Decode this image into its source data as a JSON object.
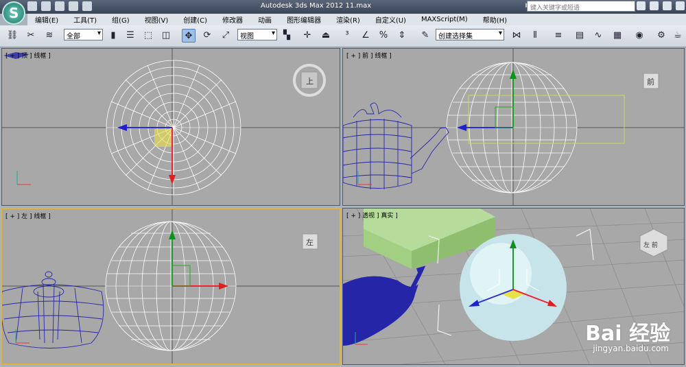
{
  "title": "Autodesk 3ds Max  2012      11.max",
  "search_placeholder": "键入关键字或短语",
  "menus": [
    "编辑(E)",
    "工具(T)",
    "组(G)",
    "视图(V)",
    "创建(C)",
    "修改器",
    "动画",
    "图形编辑器",
    "渲染(R)",
    "自定义(U)",
    "MAXScript(M)",
    "帮助(H)"
  ],
  "toolbar": {
    "filter": "全部",
    "coord": "视图",
    "selection_set": "创建选择集"
  },
  "viewports": {
    "top": {
      "label": "[ + ] 顶 ] 线框 ]",
      "cube": "上"
    },
    "front": {
      "label": "[ + ] 前 ] 线框 ]",
      "cube": "前"
    },
    "left": {
      "label": "[ + ] 左 ] 线框 ]",
      "cube": "左"
    },
    "perspective": {
      "label": "[ + ] 透视 ] 真实 ]",
      "cube": "左 前"
    }
  },
  "watermark": {
    "brand": "Bai 经验",
    "url": "jingyan.baidu.com"
  },
  "colors": {
    "viewport_bg": "#a8a8a8",
    "active_border": "#e2b23e",
    "teapot": "#2525a8",
    "box": "#a9d68a"
  }
}
